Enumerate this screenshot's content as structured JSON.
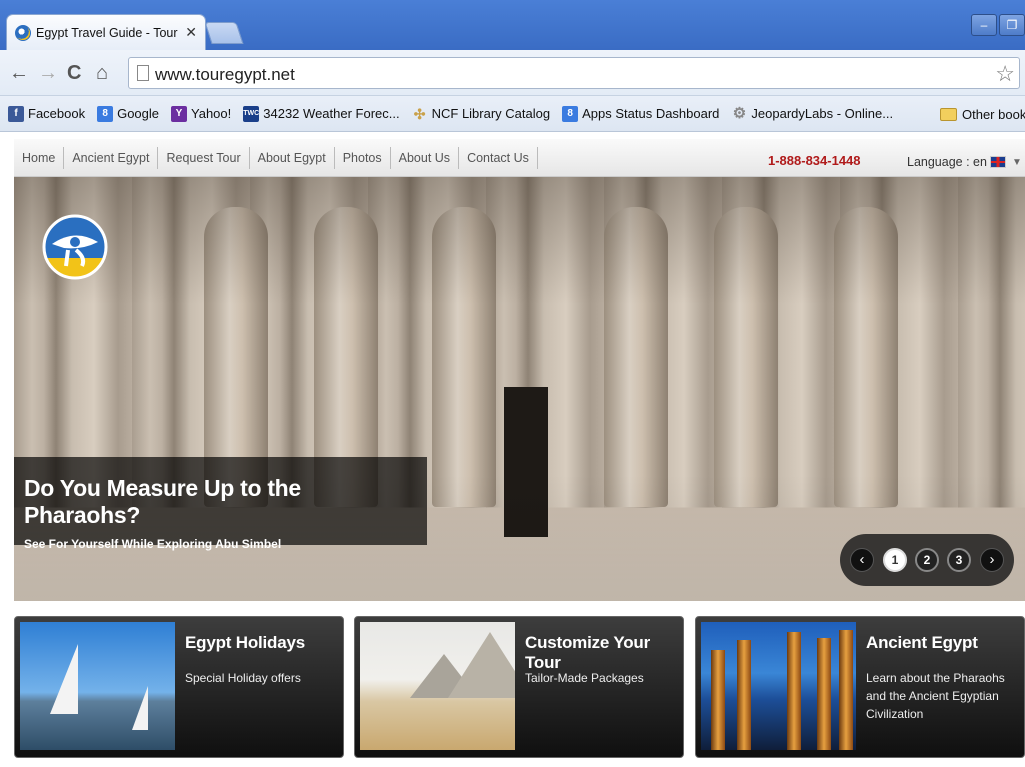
{
  "browser": {
    "tab_title": "Egypt Travel Guide - Tour Eg",
    "url": "www.touregypt.net",
    "bookmarks": [
      {
        "label": "Facebook",
        "icon": "facebook-icon",
        "color": "#3b5998"
      },
      {
        "label": "Google",
        "icon": "google-icon",
        "color": "#3a7be0"
      },
      {
        "label": "Yahoo!",
        "icon": "yahoo-icon",
        "color": "#6b2ea0"
      },
      {
        "label": "34232 Weather Forec...",
        "icon": "weather-channel-icon",
        "color": "#1a3f8a"
      },
      {
        "label": "NCF Library Catalog",
        "icon": "library-icon",
        "color": "#c9a14a"
      },
      {
        "label": "Apps Status Dashboard",
        "icon": "google-icon",
        "color": "#3a7be0"
      },
      {
        "label": "JeopardyLabs - Online...",
        "icon": "gear-icon",
        "color": "#888888"
      }
    ],
    "other_bookmarks": "Other bookm"
  },
  "site": {
    "nav": [
      "Home",
      "Ancient Egypt",
      "Request Tour",
      "About Egypt",
      "Photos",
      "About Us",
      "Contact Us"
    ],
    "phone": "1-888-834-1448",
    "language_label": "Language : en",
    "hero": {
      "headline": "Do You Measure Up to the Pharaohs?",
      "subline": "See For Yourself While Exploring Abu Simbel",
      "slides": [
        "1",
        "2",
        "3"
      ],
      "active_slide": 1
    },
    "cards": [
      {
        "title": "Egypt Holidays",
        "text": "Special Holiday offers"
      },
      {
        "title": "Customize Your Tour",
        "text": "Tailor-Made Packages"
      },
      {
        "title": "Ancient Egypt",
        "text": "Learn about the Pharaohs and the Ancient Egyptian Civilization"
      }
    ]
  }
}
